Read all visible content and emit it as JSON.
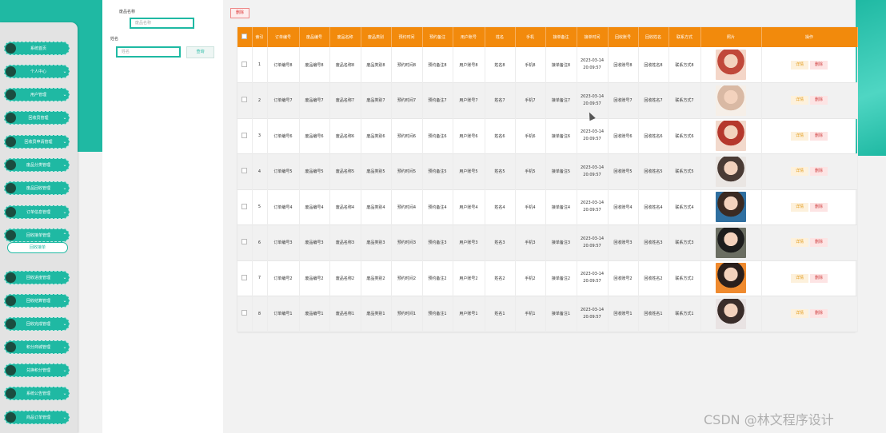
{
  "sidebar": {
    "items": [
      {
        "label": "系统首页",
        "chevron": ""
      },
      {
        "label": "个人中心",
        "chevron": "⌄"
      },
      {
        "label": "用户管理",
        "chevron": "⌄"
      },
      {
        "label": "回收员管理",
        "chevron": "⌄"
      },
      {
        "label": "回收员申请管理",
        "chevron": "⌄"
      },
      {
        "label": "废品分类管理",
        "chevron": "⌄"
      },
      {
        "label": "废品回收管理",
        "chevron": "⌄"
      },
      {
        "label": "订单信息管理",
        "chevron": "⌄"
      },
      {
        "label": "回收接单管理",
        "chevron": "⌃"
      },
      {
        "label": "回收进度管理",
        "chevron": "⌄"
      },
      {
        "label": "回收结算管理",
        "chevron": "⌄"
      },
      {
        "label": "回收完成管理",
        "chevron": "⌄"
      },
      {
        "label": "积分商城管理",
        "chevron": "⌄"
      },
      {
        "label": "兑换积分管理",
        "chevron": "⌄"
      },
      {
        "label": "系统公告管理",
        "chevron": "⌄"
      },
      {
        "label": "商品订单管理",
        "chevron": "⌄"
      },
      {
        "label": "",
        "chevron": ""
      }
    ],
    "submenu_active": "回收接单"
  },
  "search": {
    "field1_label": "废品名称",
    "field1_placeholder": "废品名称",
    "field2_label": "姓名",
    "field2_placeholder": "姓名",
    "query_button": "查询"
  },
  "toolbar": {
    "delete_label": "删除"
  },
  "table": {
    "headers": [
      "",
      "索引",
      "订单编号",
      "废品编号",
      "废品名称",
      "废品类别",
      "预约时间",
      "预约备注",
      "用户账号",
      "姓名",
      "手机",
      "接单备注",
      "接单时间",
      "回收账号",
      "回收姓名",
      "联系方式",
      "照片",
      "操作"
    ],
    "rows": [
      [
        "1",
        "订单编号8",
        "废品编号8",
        "废品名称8",
        "废品类别8",
        "预约时间8",
        "预约备注8",
        "用户账号8",
        "姓名8",
        "手机8",
        "接单备注8",
        "2023-03-14 20:09:57",
        "回收账号8",
        "回收姓名8",
        "联系方式8"
      ],
      [
        "2",
        "订单编号7",
        "废品编号7",
        "废品名称7",
        "废品类别7",
        "预约时间7",
        "预约备注7",
        "用户账号7",
        "姓名7",
        "手机7",
        "接单备注7",
        "2023-03-14 20:09:57",
        "回收账号7",
        "回收姓名7",
        "联系方式7"
      ],
      [
        "3",
        "订单编号6",
        "废品编号6",
        "废品名称6",
        "废品类别6",
        "预约时间6",
        "预约备注6",
        "用户账号6",
        "姓名6",
        "手机6",
        "接单备注6",
        "2023-03-14 20:09:57",
        "回收账号6",
        "回收姓名6",
        "联系方式6"
      ],
      [
        "4",
        "订单编号5",
        "废品编号5",
        "废品名称5",
        "废品类别5",
        "预约时间5",
        "预约备注5",
        "用户账号5",
        "姓名5",
        "手机5",
        "接单备注5",
        "2023-03-14 20:09:57",
        "回收账号5",
        "回收姓名5",
        "联系方式5"
      ],
      [
        "5",
        "订单编号4",
        "废品编号4",
        "废品名称4",
        "废品类别4",
        "预约时间4",
        "预约备注4",
        "用户账号4",
        "姓名4",
        "手机4",
        "接单备注4",
        "2023-03-14 20:09:57",
        "回收账号4",
        "回收姓名4",
        "联系方式4"
      ],
      [
        "6",
        "订单编号3",
        "废品编号3",
        "废品名称3",
        "废品类别3",
        "预约时间3",
        "预约备注3",
        "用户账号3",
        "姓名3",
        "手机3",
        "接单备注3",
        "2023-03-14 20:09:57",
        "回收账号3",
        "回收姓名3",
        "联系方式3"
      ],
      [
        "7",
        "订单编号2",
        "废品编号2",
        "废品名称2",
        "废品类别2",
        "预约时间2",
        "预约备注2",
        "用户账号2",
        "姓名2",
        "手机2",
        "接单备注2",
        "2023-03-14 20:09:57",
        "回收账号2",
        "回收姓名2",
        "联系方式2"
      ],
      [
        "8",
        "订单编号1",
        "废品编号1",
        "废品名称1",
        "废品类别1",
        "预约时间1",
        "预约备注1",
        "用户账号1",
        "姓名1",
        "手机1",
        "接单备注1",
        "2023-03-14 20:09:57",
        "回收账号1",
        "回收姓名1",
        "联系方式1"
      ]
    ],
    "actions": {
      "detail": "详情",
      "delete": "删除"
    }
  },
  "watermark": "CSDN @林文程序设计",
  "colors": {
    "accent": "#1fb9a3",
    "header": "#f28a0c",
    "danger": "#d04040"
  }
}
